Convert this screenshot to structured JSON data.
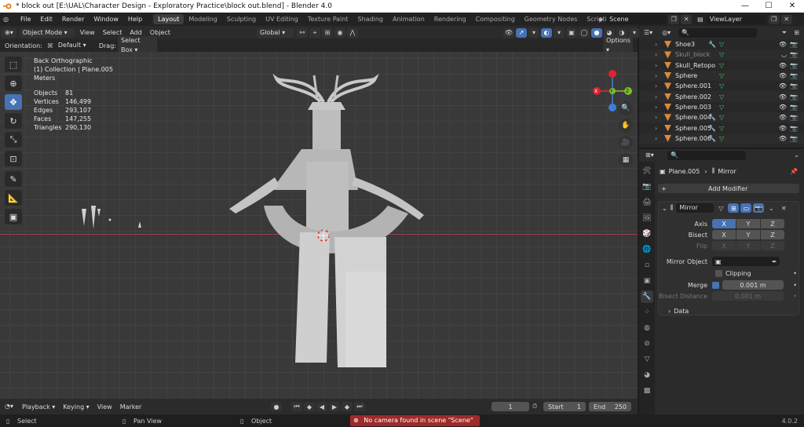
{
  "window": {
    "title": "* block out [E:\\UAL\\Character Design - Exploratory Practice\\block out.blend] - Blender 4.0",
    "min": "—",
    "max": "☐",
    "close": "✕"
  },
  "menu": {
    "items": [
      "File",
      "Edit",
      "Render",
      "Window",
      "Help"
    ],
    "workspaces": [
      "Layout",
      "Modeling",
      "Sculpting",
      "UV Editing",
      "Texture Paint",
      "Shading",
      "Animation",
      "Rendering",
      "Compositing",
      "Geometry Nodes",
      "Scripting"
    ],
    "add": "+",
    "scene": "Scene",
    "viewlayer": "ViewLayer"
  },
  "viewport_header": {
    "mode": "Object Mode",
    "menus": [
      "View",
      "Select",
      "Add",
      "Object"
    ],
    "transform": "Global"
  },
  "tool_settings": {
    "orientation_label": "Orientation:",
    "orientation": "Default",
    "drag_label": "Drag:",
    "drag": "Select Box",
    "options": "Options"
  },
  "overlay": {
    "view": "Back Orthographic",
    "collection": "(1) Collection | Plane.005",
    "units": "Meters",
    "stats": [
      {
        "k": "Objects",
        "v": "81"
      },
      {
        "k": "Vertices",
        "v": "146,499"
      },
      {
        "k": "Edges",
        "v": "293,107"
      },
      {
        "k": "Faces",
        "v": "147,255"
      },
      {
        "k": "Triangles",
        "v": "290,130"
      }
    ]
  },
  "gizmo": {
    "x": "X",
    "y": "Y",
    "z": "Z"
  },
  "outliner": {
    "rows": [
      {
        "name": "Shoe3",
        "dim": false,
        "mods": "🔧",
        "mesh": "▽"
      },
      {
        "name": "Skull_block",
        "dim": true,
        "mods": "",
        "mesh": "▽"
      },
      {
        "name": "Skull_Retopo",
        "dim": false,
        "mods": "",
        "mesh": "▽"
      },
      {
        "name": "Sphere",
        "dim": false,
        "mods": "",
        "mesh": "▽"
      },
      {
        "name": "Sphere.001",
        "dim": false,
        "mods": "",
        "mesh": "▽"
      },
      {
        "name": "Sphere.002",
        "dim": false,
        "mods": "",
        "mesh": "▽"
      },
      {
        "name": "Sphere.003",
        "dim": false,
        "mods": "",
        "mesh": "▽"
      },
      {
        "name": "Sphere.004",
        "dim": false,
        "mods": "🔧",
        "mesh": "▽"
      },
      {
        "name": "Sphere.005",
        "dim": false,
        "mods": "🔧",
        "mesh": "▽"
      },
      {
        "name": "Sphere.006",
        "dim": false,
        "mods": "🔧",
        "mesh": "▽"
      }
    ]
  },
  "properties": {
    "object": "Plane.005",
    "modifier_crumb": "Mirror",
    "add_modifier": "Add Modifier",
    "modifier": {
      "name": "Mirror",
      "axis_label": "Axis",
      "bisect_label": "Bisect",
      "flip_label": "Flip",
      "x": "X",
      "y": "Y",
      "z": "Z",
      "mirror_object_label": "Mirror Object",
      "clipping_label": "Clipping",
      "merge_label": "Merge",
      "merge_value": "0.001 m",
      "bisect_distance_label": "Bisect Distance",
      "bisect_distance_value": "0.001 m",
      "data_label": "Data"
    }
  },
  "timeline": {
    "menus": [
      "Playback",
      "Keying",
      "View",
      "Marker"
    ],
    "current_frame": "1",
    "start_label": "Start",
    "start": "1",
    "end_label": "End",
    "end": "250"
  },
  "status": {
    "select": "Select",
    "pan": "Pan View",
    "object": "Object",
    "warning": "No camera found in scene \"Scene\"",
    "version": "4.0.2"
  }
}
